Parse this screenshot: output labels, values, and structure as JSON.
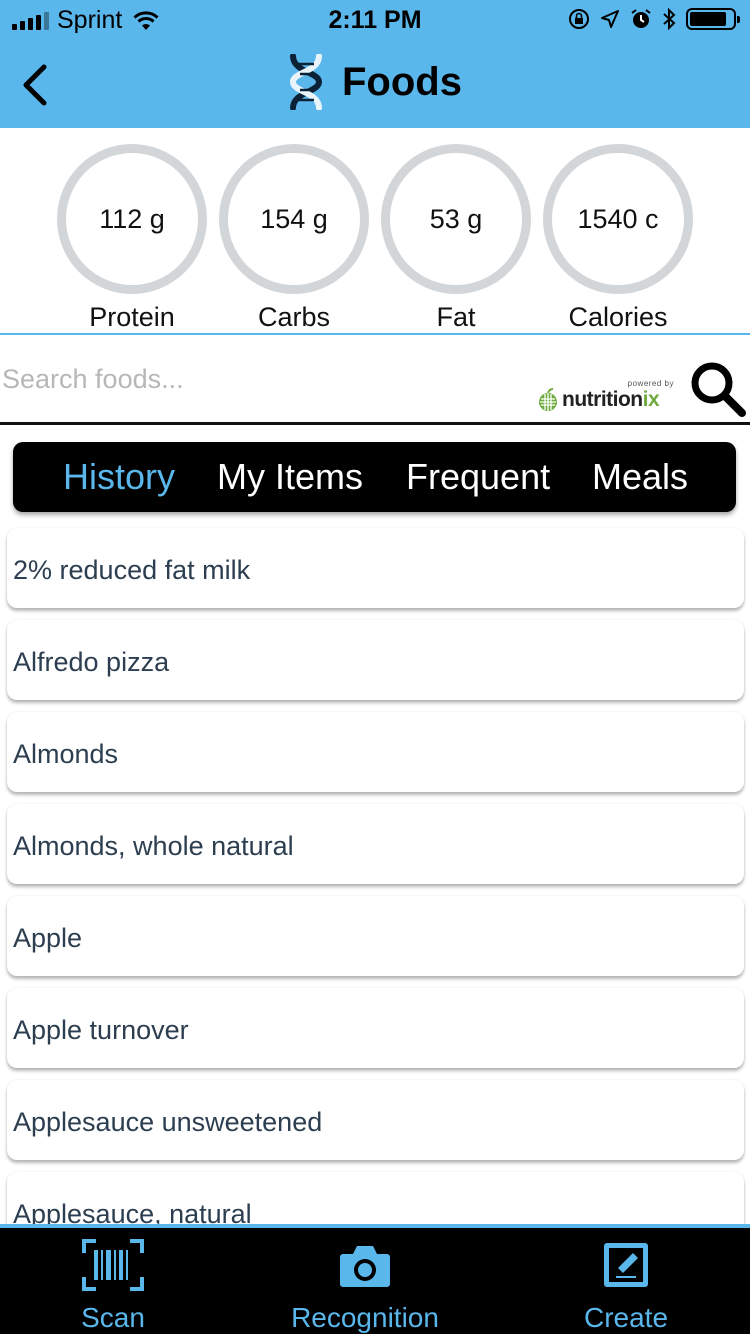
{
  "status_bar": {
    "carrier": "Sprint",
    "time": "2:11 PM",
    "signal_bars": 4,
    "signal_total": 5,
    "battery_level": 0.85
  },
  "nav": {
    "title": "Foods",
    "back_icon": "chevron-left-icon",
    "logo_icon": "dna-icon"
  },
  "macros": [
    {
      "value": "112 g",
      "label": "Protein"
    },
    {
      "value": "154 g",
      "label": "Carbs"
    },
    {
      "value": "53 g",
      "label": "Fat"
    },
    {
      "value": "1540 c",
      "label": "Calories"
    }
  ],
  "search": {
    "placeholder": "Search foods...",
    "value": "",
    "powered_by": "powered by",
    "brand_main": "nutrition",
    "brand_accent": "ix"
  },
  "tabs": [
    {
      "label": "History",
      "active": true
    },
    {
      "label": "My Items",
      "active": false
    },
    {
      "label": "Frequent",
      "active": false
    },
    {
      "label": "Meals",
      "active": false
    }
  ],
  "foods": [
    "2% reduced fat milk",
    "Alfredo pizza",
    "Almonds",
    "Almonds, whole natural",
    "Apple",
    "Apple turnover",
    "Applesauce unsweetened",
    "Applesauce, natural"
  ],
  "bottom_bar": {
    "scan": "Scan",
    "recognition": "Recognition",
    "create": "Create"
  },
  "colors": {
    "accent": "#5ab7ec",
    "ring": "#d3d6d8",
    "tab_bg": "#000000",
    "brand_green": "#6fab3f"
  }
}
